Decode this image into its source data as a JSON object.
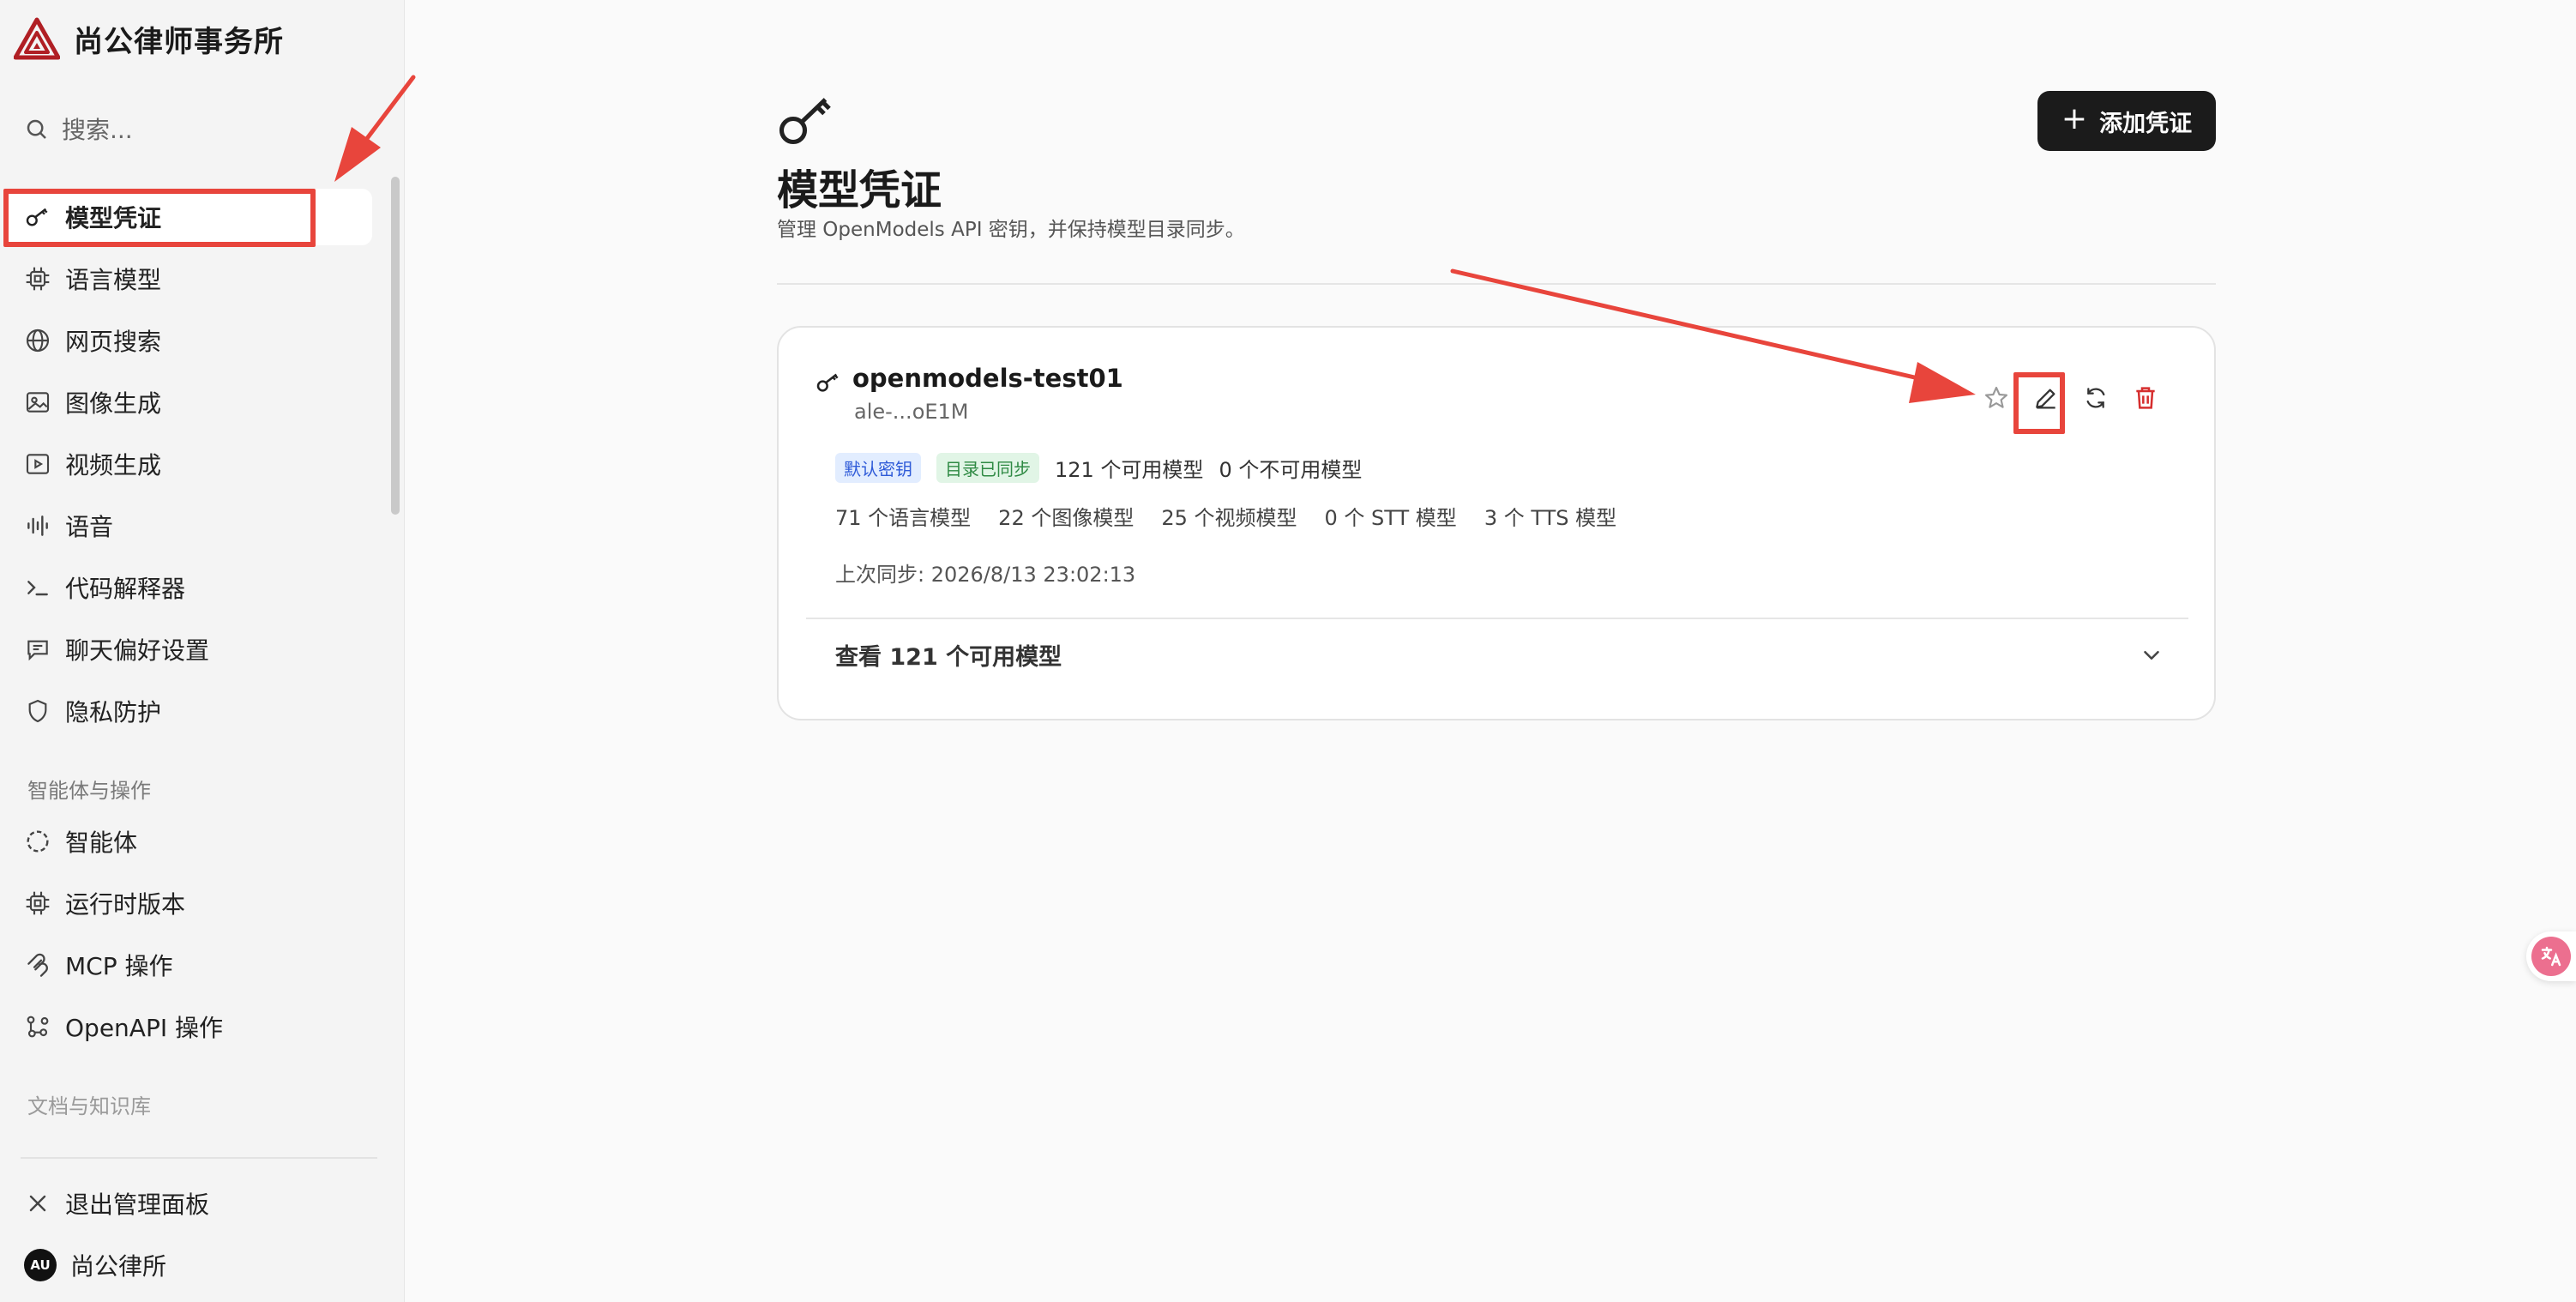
{
  "brand": {
    "name": "尚公律师事务所"
  },
  "search": {
    "placeholder": "搜索..."
  },
  "sidebar": {
    "items": [
      {
        "label": "模型凭证",
        "icon": "key-icon"
      },
      {
        "label": "语言模型",
        "icon": "chip-icon"
      },
      {
        "label": "网页搜索",
        "icon": "globe-icon"
      },
      {
        "label": "图像生成",
        "icon": "image-icon"
      },
      {
        "label": "视频生成",
        "icon": "video-icon"
      },
      {
        "label": "语音",
        "icon": "audio-wave-icon"
      },
      {
        "label": "代码解释器",
        "icon": "terminal-icon"
      },
      {
        "label": "聊天偏好设置",
        "icon": "chat-icon"
      },
      {
        "label": "隐私防护",
        "icon": "shield-icon"
      }
    ],
    "section_agents": "智能体与操作",
    "agent_items": [
      {
        "label": "智能体",
        "icon": "dashed-circle-icon"
      },
      {
        "label": "运行时版本",
        "icon": "chip-icon"
      },
      {
        "label": "MCP 操作",
        "icon": "mcp-icon"
      },
      {
        "label": "OpenAPI 操作",
        "icon": "nodes-icon"
      }
    ],
    "section_docs": "文档与知识库",
    "exit_label": "退出管理面板",
    "user_initials": "AU",
    "user_name": "尚公律所"
  },
  "page": {
    "title": "模型凭证",
    "subtitle": "管理 OpenModels API 密钥，并保持模型目录同步。",
    "add_button": "添加凭证"
  },
  "credential": {
    "name": "openmodels-test01",
    "masked_key": "ale-...oE1M",
    "tags": [
      "默认密钥",
      "目录已同步"
    ],
    "available": "121 个可用模型",
    "unavailable": "0 个不可用模型",
    "counts": [
      "71 个语言模型",
      "22 个图像模型",
      "25 个视频模型",
      "0 个 STT 模型",
      "3 个 TTS 模型"
    ],
    "last_sync": "上次同步: 2026/8/13 23:02:13",
    "view_models": "查看 121 个可用模型"
  },
  "colors": {
    "accent_red": "#e8453c",
    "tag_blue": "#2f5bd8",
    "tag_green": "#2f8a44",
    "delete_red": "#d62f2f",
    "brand_red": "#b01f24"
  }
}
